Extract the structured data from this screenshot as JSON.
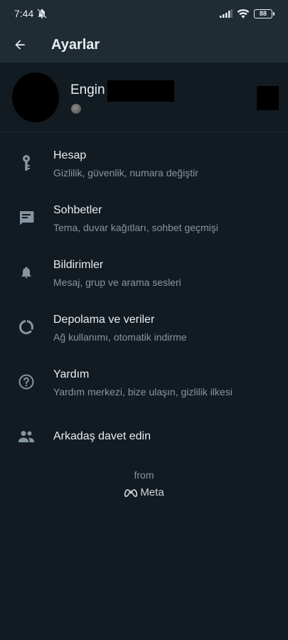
{
  "status_bar": {
    "time": "7:44",
    "battery": "88"
  },
  "app_bar": {
    "title": "Ayarlar"
  },
  "profile": {
    "name": "Engin"
  },
  "menu": [
    {
      "title": "Hesap",
      "subtitle": "Gizlilik, güvenlik, numara değiştir",
      "icon": "key-icon"
    },
    {
      "title": "Sohbetler",
      "subtitle": "Tema, duvar kağıtları, sohbet geçmişi",
      "icon": "chat-icon"
    },
    {
      "title": "Bildirimler",
      "subtitle": "Mesaj, grup ve arama sesleri",
      "icon": "bell-icon"
    },
    {
      "title": "Depolama ve veriler",
      "subtitle": "Ağ kullanımı, otomatik indirme",
      "icon": "data-usage-icon"
    },
    {
      "title": "Yardım",
      "subtitle": "Yardım merkezi, bize ulaşın, gizlilik ilkesi",
      "icon": "help-icon"
    },
    {
      "title": "Arkadaş davet edin",
      "icon": "people-icon"
    }
  ],
  "footer": {
    "from": "from",
    "brand": "Meta"
  },
  "colors": {
    "background": "#121b22",
    "app_bar": "#1f2c34",
    "primary_text": "#e9edef",
    "secondary_text": "#8696a0",
    "icon": "#8696a0"
  }
}
